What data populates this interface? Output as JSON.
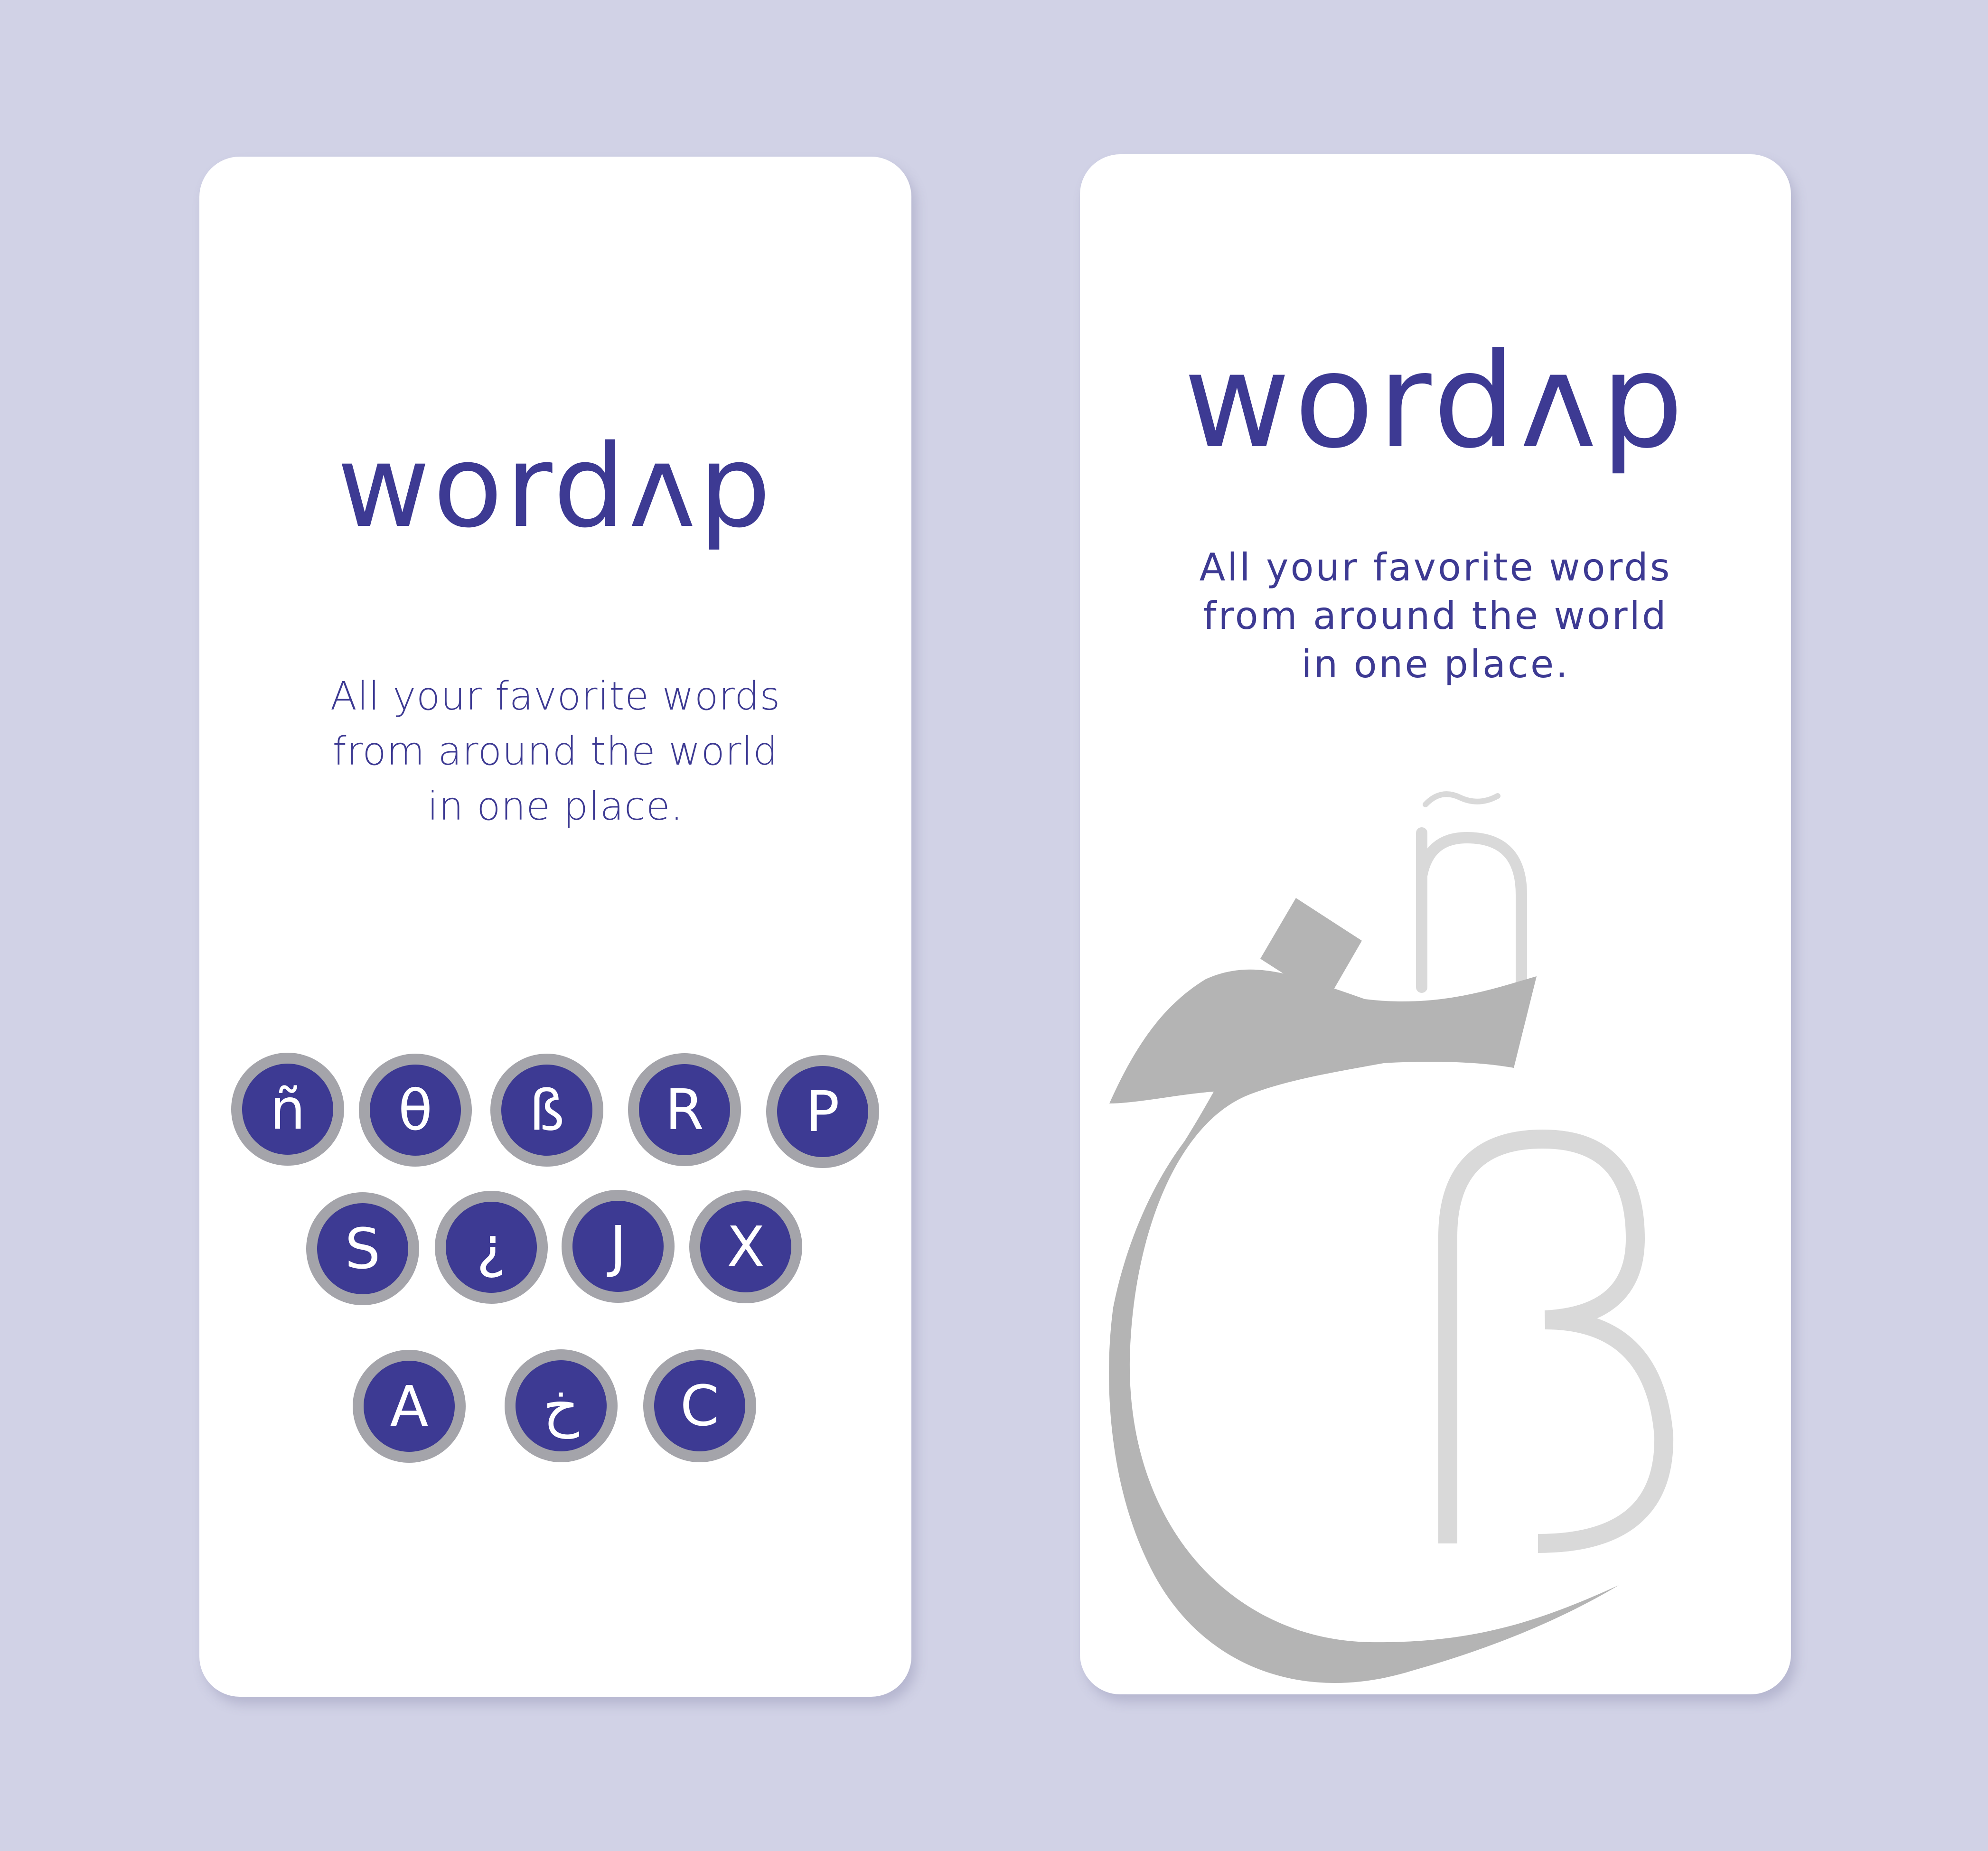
{
  "screens": [
    {
      "logo": "wordʌp",
      "tagline": [
        "All your favorite words",
        "from around the world",
        "in one place."
      ],
      "keys": [
        [
          "ñ",
          "θ",
          "ß",
          "R",
          "P"
        ],
        [
          "S",
          "¿",
          "J",
          "X"
        ],
        [
          "A",
          "خ",
          "C"
        ]
      ]
    },
    {
      "logo": "wordʌp",
      "tagline": [
        "All your favorite words",
        "from around the world",
        "in one place."
      ],
      "decorative_glyphs": [
        "ñ",
        "ß"
      ]
    }
  ],
  "colors": {
    "background": "#d1d2e6",
    "card": "#ffffff",
    "brand": "#3d3a93",
    "key_ring": "#a4a4aa",
    "decor_dark": "#b4b4b4",
    "decor_light": "#d9d9d9"
  }
}
